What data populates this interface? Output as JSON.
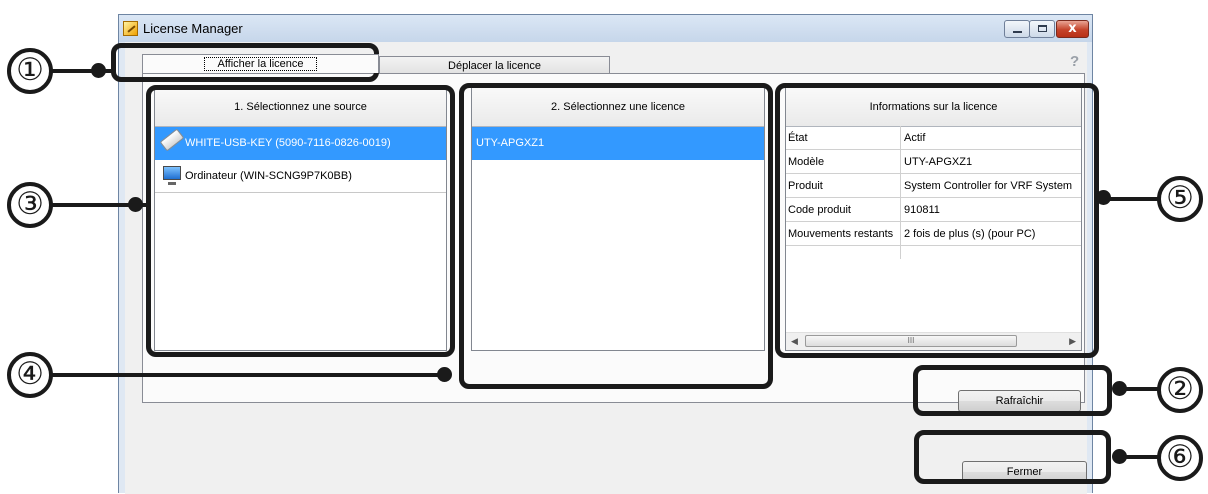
{
  "window": {
    "title": "License Manager",
    "minimize_glyph": "minimize-icon",
    "maximize_glyph": "maximize-icon",
    "close_glyph": "x"
  },
  "tabs": [
    {
      "label": "Afficher la licence",
      "active": true
    },
    {
      "label": "Déplacer la licence",
      "active": false
    }
  ],
  "help": "?",
  "sources": {
    "header": "1. Sélectionnez une source",
    "items": [
      {
        "label": "WHITE-USB-KEY (5090-7116-0826-0019)",
        "icon": "usb-key-icon",
        "selected": true
      },
      {
        "label": "Ordinateur (WIN-SCNG9P7K0BB)",
        "icon": "computer-icon",
        "selected": false
      }
    ]
  },
  "licenses": {
    "header": "2. Sélectionnez une licence",
    "items": [
      {
        "label": "UTY-APGXZ1",
        "selected": true
      }
    ]
  },
  "info": {
    "header": "Informations sur la licence",
    "rows": [
      {
        "key": "État",
        "value": "Actif"
      },
      {
        "key": "Modèle",
        "value": "UTY-APGXZ1"
      },
      {
        "key": "Produit",
        "value": "System Controller for VRF System"
      },
      {
        "key": "Code produit",
        "value": "910811"
      },
      {
        "key": "Mouvements restants",
        "value": "2 fois de plus (s) (pour PC)"
      }
    ],
    "scroll_grip": "III",
    "scroll_left": "◀",
    "scroll_right": "▶"
  },
  "buttons": {
    "refresh": "Rafraîchir",
    "close": "Fermer"
  },
  "callouts": [
    "①",
    "②",
    "③",
    "④",
    "⑤",
    "⑥"
  ],
  "colors": {
    "selection": "#3399ff",
    "callout": "#1a1a1a"
  }
}
